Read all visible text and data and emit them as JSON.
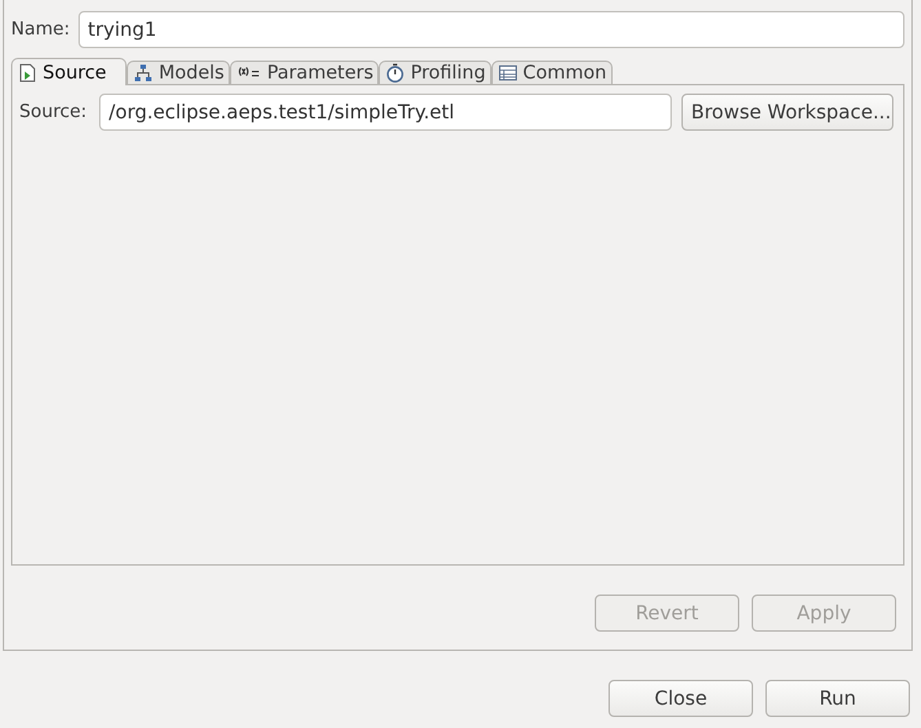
{
  "name_field": {
    "label": "Name:",
    "value": "trying1"
  },
  "tabs": [
    {
      "label": "Source",
      "selected": true
    },
    {
      "label": "Models",
      "selected": false
    },
    {
      "label": "Parameters",
      "selected": false
    },
    {
      "label": "Profiling",
      "selected": false
    },
    {
      "label": "Common",
      "selected": false
    }
  ],
  "source_field": {
    "label": "Source:",
    "value": "/org.eclipse.aeps.test1/simpleTry.etl",
    "button": "Browse Workspace..."
  },
  "panel_buttons": [
    {
      "label": "Revert",
      "disabled": true
    },
    {
      "label": "Apply",
      "disabled": true
    }
  ],
  "dialog_buttons": [
    {
      "label": "Close",
      "disabled": false
    },
    {
      "label": "Run",
      "disabled": false
    }
  ]
}
